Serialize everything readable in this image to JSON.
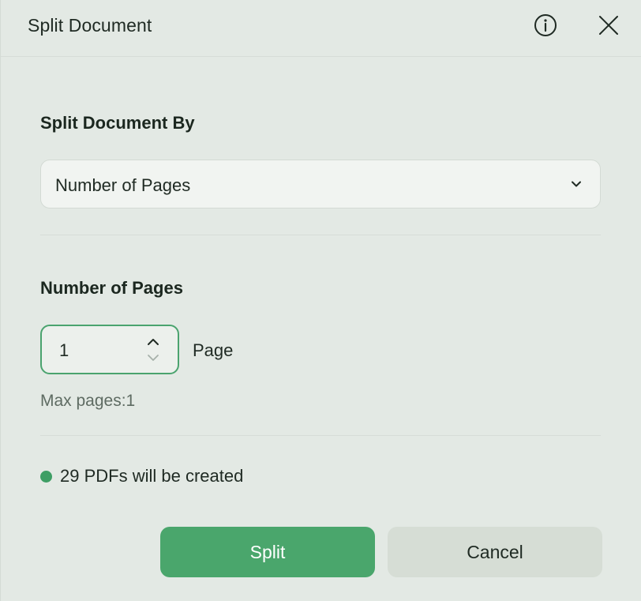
{
  "dialog": {
    "title": "Split Document"
  },
  "icons": {
    "info": "info-icon",
    "close": "close-icon",
    "chevron": "chevron-down-icon",
    "step_up": "chevron-up-icon",
    "step_down": "chevron-down-icon"
  },
  "split_by": {
    "label": "Split Document By",
    "selected": "Number of Pages"
  },
  "pages": {
    "label": "Number of Pages",
    "value": "1",
    "unit": "Page",
    "max_text": "Max pages:1"
  },
  "status": {
    "text": "29 PDFs will be created",
    "dot_color": "#3d9e64"
  },
  "buttons": {
    "split": "Split",
    "cancel": "Cancel"
  },
  "colors": {
    "accent": "#4aa66c",
    "background": "#e3e9e4"
  }
}
